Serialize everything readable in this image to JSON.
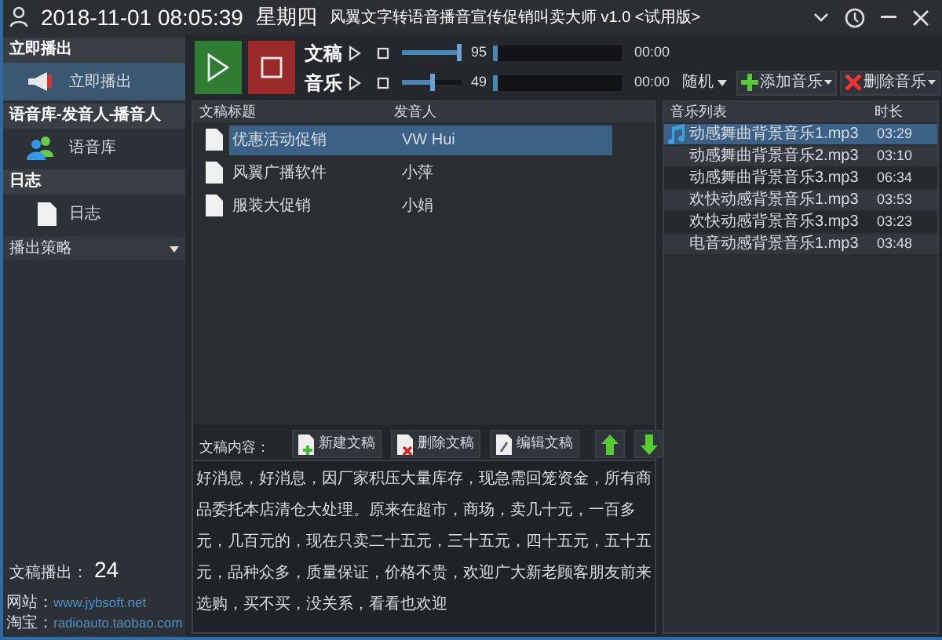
{
  "title_bar": {
    "datetime": "2018-11-01 08:05:39",
    "weekday": "星期四",
    "title": "风翼文字转语音播音宣传促销叫卖大师 v1.0 <试用版>"
  },
  "sidebar": {
    "sections": [
      {
        "header": "立即播出",
        "items": [
          {
            "label": "立即播出",
            "kind": "megaphone",
            "selected": true
          }
        ]
      },
      {
        "header": "语音库-发音人-播音人",
        "items": [
          {
            "label": "语音库",
            "kind": "people",
            "selected": false
          }
        ]
      },
      {
        "header": "日志",
        "items": [
          {
            "label": "日志",
            "kind": "document",
            "selected": false
          }
        ]
      }
    ],
    "strategy_dropdown": "播出策略",
    "stats": {
      "label": "文稿播出：",
      "value": "24"
    },
    "links": [
      {
        "label": "网站：",
        "url": "www.jybsoft.net"
      },
      {
        "label": "淘宝：",
        "url": "radioauto.taobao.com"
      }
    ]
  },
  "channels": [
    {
      "name": "文稿",
      "volume": {
        "level": 0.95,
        "reading": "95"
      },
      "progress": {
        "level": 0,
        "time": "00:00"
      }
    },
    {
      "name": "音乐",
      "volume": {
        "level": 0.49,
        "reading": "49"
      },
      "progress": {
        "level": 0,
        "time": "00:00"
      }
    }
  ],
  "play_mode": "随机",
  "music_buttons": [
    {
      "label": "添加音乐",
      "kind": "add"
    },
    {
      "label": "删除音乐",
      "kind": "delete"
    }
  ],
  "scripts": {
    "columns": [
      "文稿标题",
      "发音人"
    ],
    "rows": [
      {
        "title": "优惠活动促销",
        "speaker": "VW Hui",
        "selected": true
      },
      {
        "title": "风翼广播软件",
        "speaker": "小萍",
        "selected": false
      },
      {
        "title": "服装大促销",
        "speaker": "小娟",
        "selected": false
      }
    ]
  },
  "script_toolbar": {
    "label": "文稿内容：",
    "buttons": [
      {
        "label": "新建文稿",
        "kind": "new"
      },
      {
        "label": "删除文稿",
        "kind": "delete"
      },
      {
        "label": "编辑文稿",
        "kind": "edit"
      },
      {
        "kind": "up"
      },
      {
        "kind": "down"
      }
    ]
  },
  "script_content": "好消息，好消息，因厂家积压大量库存，现急需回笼资金，所有商品委托本店清仓大处理。原来在超市，商场，卖几十元，一百多元，几百元的，现在只卖二十五元，三十五元，四十五元，五十五元，品种众多，质量保证，价格不贵，欢迎广大新老顾客朋友前来选购，买不买，没关系，看看也欢迎",
  "music": {
    "columns": [
      "音乐列表",
      "时长"
    ],
    "rows": [
      {
        "name": "动感舞曲背景音乐1.mp3",
        "duration": "03:29",
        "selected": true
      },
      {
        "name": "动感舞曲背景音乐2.mp3",
        "duration": "03:10",
        "selected": false
      },
      {
        "name": "动感舞曲背景音乐3.mp3",
        "duration": "06:34",
        "selected": false
      },
      {
        "name": "欢快动感背景音乐1.mp3",
        "duration": "03:53",
        "selected": false
      },
      {
        "name": "欢快动感背景音乐3.mp3",
        "duration": "03:23",
        "selected": false
      },
      {
        "name": "电音动感背景音乐1.mp3",
        "duration": "03:48",
        "selected": false
      }
    ]
  }
}
